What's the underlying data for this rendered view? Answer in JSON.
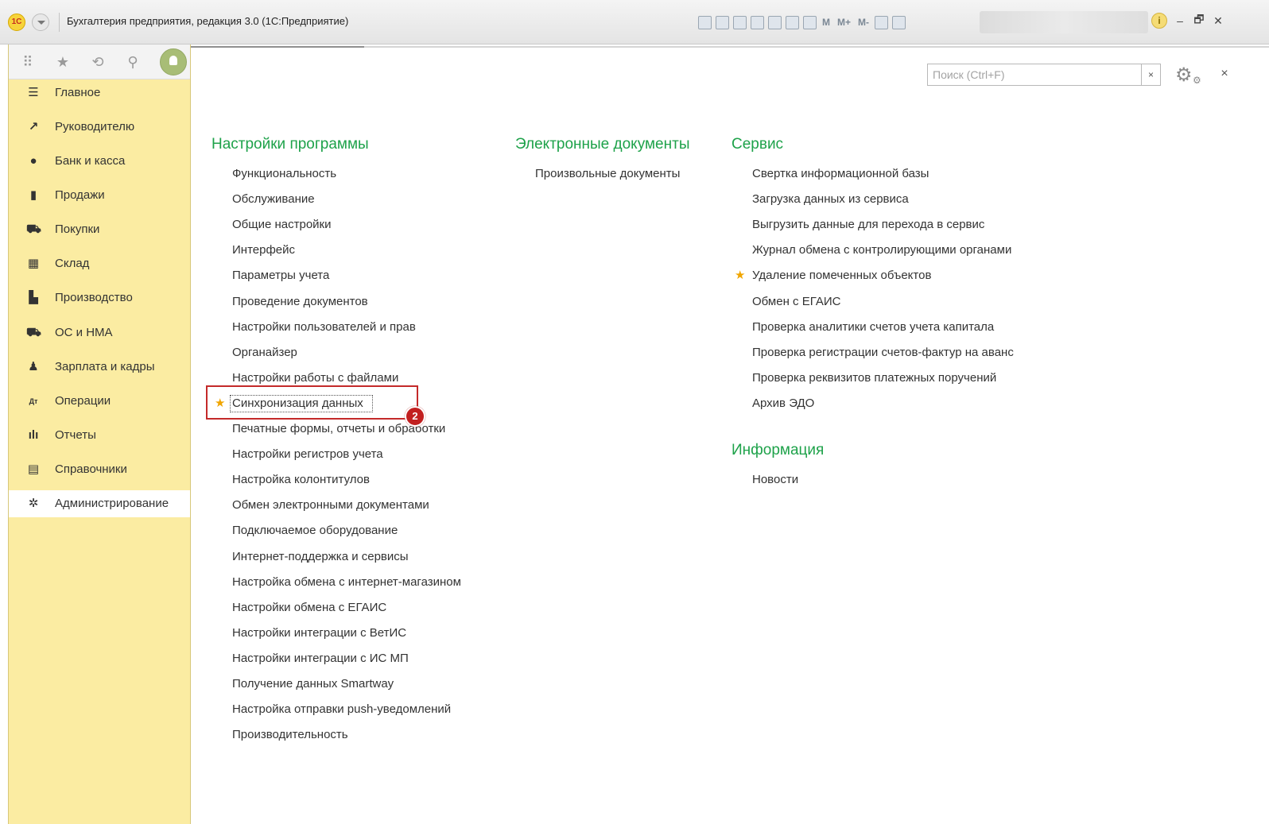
{
  "titlebar": {
    "logo": "1С",
    "title": "Бухгалтерия предприятия, редакция 3.0  (1С:Предприятие)",
    "tools": [
      "M",
      "M+",
      "M-"
    ],
    "info": "i",
    "minimize": "–",
    "restore": "🗗",
    "close": "✕"
  },
  "sidebar": {
    "top_icons": [
      "apps-grid-icon",
      "star-icon",
      "history-icon",
      "search-icon",
      "user-avatar"
    ],
    "items": [
      {
        "label": "Главное",
        "icon": "☰"
      },
      {
        "label": "Руководителю",
        "icon": "↗"
      },
      {
        "label": "Банк и касса",
        "icon": "●"
      },
      {
        "label": "Продажи",
        "icon": "▮"
      },
      {
        "label": "Покупки",
        "icon": "⛟"
      },
      {
        "label": "Склад",
        "icon": "▦"
      },
      {
        "label": "Производство",
        "icon": "▙"
      },
      {
        "label": "ОС и НМА",
        "icon": "⛟"
      },
      {
        "label": "Зарплата и кадры",
        "icon": "♟"
      },
      {
        "label": "Операции",
        "icon": "Дт"
      },
      {
        "label": "Отчеты",
        "icon": "ılı"
      },
      {
        "label": "Справочники",
        "icon": "▤"
      },
      {
        "label": "Администрирование",
        "icon": "✲"
      }
    ],
    "active_index": 12
  },
  "search": {
    "placeholder": "Поиск (Ctrl+F)",
    "value": "",
    "clear": "×"
  },
  "close_label": "×",
  "sections": {
    "program_settings": {
      "title": "Настройки программы",
      "links": [
        "Функциональность",
        "Обслуживание",
        "Общие настройки",
        "Интерфейс",
        "Параметры учета",
        "Проведение документов",
        "Настройки пользователей и прав",
        "Органайзер",
        "Настройки работы с файлами",
        "Синхронизация данных",
        "Печатные формы, отчеты и обработки",
        "Настройки регистров учета",
        "Настройка колонтитулов",
        "Обмен электронными документами",
        "Подключаемое оборудование",
        "Интернет-поддержка и сервисы",
        "Настройка обмена с интернет-магазином",
        "Настройки обмена с ЕГАИС",
        "Настройки интеграции с ВетИС",
        "Настройки интеграции с ИС МП",
        "Получение данных Smartway",
        "Настройка отправки push-уведомлений",
        "Производительность"
      ]
    },
    "edocs": {
      "title": "Электронные документы",
      "links": [
        "Произвольные документы"
      ]
    },
    "service": {
      "title": "Сервис",
      "links": [
        "Свертка информационной базы",
        "Загрузка данных из сервиса",
        "Выгрузить данные для перехода в сервис",
        "Журнал обмена с контролирующими органами",
        "Удаление помеченных объектов",
        "Обмен с ЕГАИС",
        "Проверка аналитики счетов учета капитала",
        "Проверка регистрации счетов-фактур на аванс",
        "Проверка реквизитов платежных поручений",
        "Архив ЭДО"
      ]
    },
    "info": {
      "title": "Информация",
      "links": [
        "Новости"
      ]
    }
  },
  "star_glyph": "★",
  "annotation_badge": "2",
  "colors": {
    "accent_green": "#1ea24a",
    "sidebar_bg": "#fbeca2",
    "highlight_red": "#c42a2a",
    "star": "#f0a500"
  }
}
